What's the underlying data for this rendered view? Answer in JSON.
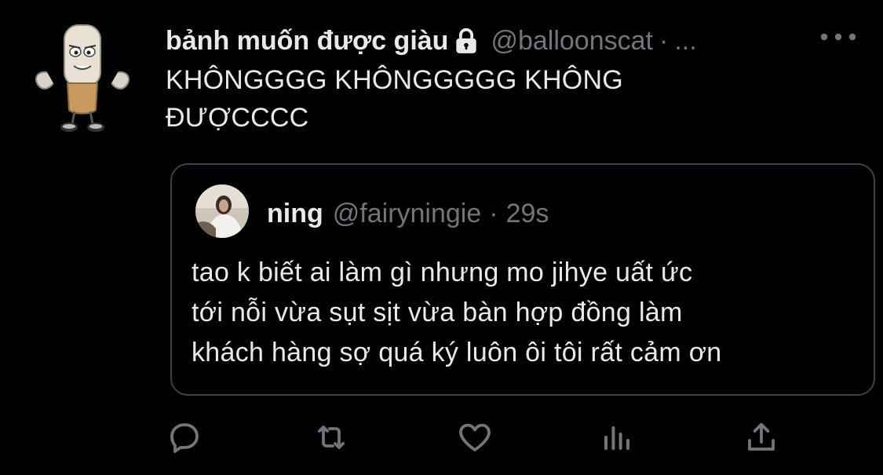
{
  "author": {
    "display_name": "bảnh muốn được giàu",
    "handle": "@balloonscat",
    "separator": "·",
    "timestamp": "...",
    "protected_icon": "lock-icon",
    "avatar_icon": "cigarette-cartoon-avatar"
  },
  "tweet": {
    "text_line1": "KHÔNGGGG KHÔNGGGGG KHÔNG",
    "text_line2": "ĐƯỢCCCC"
  },
  "quoted": {
    "display_name": "ning",
    "handle": "@fairyningie",
    "separator": "·",
    "timestamp": "29s",
    "text_line1": "tao k biết ai làm gì nhưng mo jihye uất ức",
    "text_line2": "tới nỗi vừa sụt sịt vừa bàn hợp đồng làm",
    "text_line3": "khách hàng sợ quá ký luôn ôi tôi rất cảm ơn"
  },
  "actions": {
    "reply_icon": "reply-icon",
    "retweet_icon": "retweet-icon",
    "like_icon": "heart-icon",
    "analytics_icon": "analytics-icon",
    "share_icon": "share-icon"
  },
  "colors": {
    "background": "#000000",
    "text": "#e7e9ea",
    "secondary": "#71767b",
    "border": "#38444d"
  }
}
